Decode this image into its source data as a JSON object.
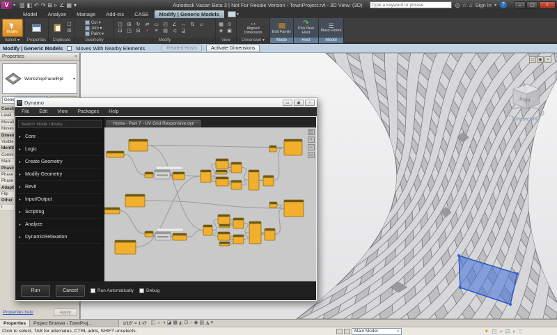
{
  "title_bar": {
    "app_title": "Autodesk Vasari Beta 3 | Not For Resale Version - TownProject.rvt - 3D View: (3D)",
    "search_placeholder": "Type a keyword or phrase",
    "sign_in_label": "Sign In",
    "qat_icons": [
      [
        "open-icon",
        "▥"
      ],
      [
        "save-icon",
        "◧"
      ],
      [
        "undo-icon",
        "↶"
      ],
      [
        "redo-icon",
        "↷"
      ],
      [
        "print-icon",
        "⊞"
      ],
      [
        "modify-icon",
        "▹"
      ],
      [
        "measure-icon",
        "∠"
      ],
      [
        "default-3d-view-icon",
        "▦"
      ],
      [
        "qat-more-icon",
        "▾"
      ]
    ],
    "title_icons": [
      [
        "search-icon",
        "◎"
      ],
      [
        "favorites-icon",
        "☆"
      ],
      [
        "communication-center-icon",
        "⌂"
      ]
    ],
    "window_buttons": [
      "–",
      "▢",
      "×"
    ]
  },
  "ribbon": {
    "tabs": [
      "Model",
      "Analyze",
      "Manage",
      "Add-Ins",
      "CASE"
    ],
    "context_tab": "Modify | Generic Models",
    "select_label": "Select ▾",
    "select_button": "Modify",
    "properties_label": "Properties",
    "clipboard_label": "Clipboard",
    "geometry_label": "Geometry",
    "geometry_items": [
      "Cut ▾",
      "Join ▾",
      "Paint ▾"
    ],
    "modify_label": "Modify",
    "modify_icons": [
      "◫",
      "⊞",
      "↻",
      "⇄",
      "▭",
      "◰",
      "∠",
      "↔",
      "⇅",
      "▱",
      "⊡",
      "◳",
      "⊟",
      "×",
      "≡",
      "▤",
      "◁",
      "⊒"
    ],
    "view_label": "View",
    "view_icons": [
      "▦",
      "⊙",
      "◈",
      "▣"
    ],
    "dimension_label": "Dimension ▾",
    "dimension_button": "Aligned Dimension",
    "mode_label": "Mode",
    "mode_button": "Edit Family",
    "host_label": "Host",
    "host_button": "Pick New Host",
    "model_label": "Model",
    "model_button": "Mass Floors"
  },
  "options_bar": {
    "context_label": "Modify | Generic Models",
    "checkbox_label": "Moves With Nearby Elements",
    "related_hosts_label": "Related Hosts",
    "activate_dimensions_label": "Activate Dimensions"
  },
  "properties_panel": {
    "header": "Properties",
    "type_name": "WorkshopPanelRpt",
    "category_selector": "Generic Models (1)",
    "edit_type_label": "Edit Type",
    "rows": [
      {
        "label": "Constraints",
        "section": true
      },
      {
        "label": "Level",
        "section": false
      },
      {
        "label": "Elevation",
        "section": false
      },
      {
        "label": "Moves With Nearby",
        "section": false
      },
      {
        "label": "Dimensions",
        "section": true
      },
      {
        "label": "Visible",
        "section": false
      },
      {
        "label": "Identity Data",
        "section": true
      },
      {
        "label": "Comments",
        "section": false
      },
      {
        "label": "Mark",
        "section": false
      },
      {
        "label": "Phasing",
        "section": true
      },
      {
        "label": "Phase Created",
        "section": false
      },
      {
        "label": "Phase Demolished",
        "section": false
      },
      {
        "label": "Adaptive Component",
        "section": true
      },
      {
        "label": "Flip",
        "section": false
      },
      {
        "label": "Other",
        "section": true
      },
      {
        "label": "t",
        "section": false
      }
    ],
    "help_link": "Properties help",
    "apply_label": "Apply"
  },
  "dynamo": {
    "window_title": "Dynamo",
    "window_buttons": [
      "▭",
      "▣",
      "×"
    ],
    "menus": [
      "File",
      "Edit",
      "View",
      "Packages",
      "Help"
    ],
    "search_placeholder": "Search Node Library...",
    "categories": [
      "Core",
      "Logic",
      "Create Geometry",
      "Modify Geometry",
      "Revit",
      "Input/Output",
      "Scripting",
      "Analyze",
      "DynamicRelaxation"
    ],
    "tab_label": "Home - Part 7 - UV Grid Responsive.dyn",
    "canvas_buttons": [
      "◰",
      "+",
      "−",
      "▭"
    ],
    "run_label": "Run",
    "cancel_label": "Cancel",
    "run_auto_label": "Run Automatically",
    "debug_label": "Debug",
    "node_color": "#f2ae2d",
    "node_header_color": "#6b5a17",
    "wire_color": "#9a9a9a",
    "nodes": [
      [
        35,
        17,
        27,
        17,
        "y"
      ],
      [
        3,
        34,
        25,
        9,
        "y"
      ],
      [
        58,
        64,
        12,
        8,
        "y"
      ],
      [
        72,
        61,
        22,
        13,
        "g"
      ],
      [
        98,
        64,
        17,
        11,
        "y"
      ],
      [
        138,
        61,
        15,
        18,
        "y"
      ],
      [
        160,
        45,
        18,
        14,
        "y"
      ],
      [
        160,
        61,
        16,
        6,
        "y"
      ],
      [
        182,
        50,
        15,
        15,
        "y"
      ],
      [
        160,
        71,
        18,
        13,
        "y"
      ],
      [
        182,
        76,
        15,
        13,
        "y"
      ],
      [
        207,
        61,
        15,
        29,
        "y"
      ],
      [
        228,
        69,
        15,
        15,
        "y"
      ],
      [
        237,
        26,
        10,
        9,
        "y"
      ],
      [
        258,
        17,
        26,
        23,
        "y"
      ],
      [
        30,
        96,
        28,
        18,
        "y"
      ],
      [
        0,
        115,
        22,
        9,
        "y"
      ],
      [
        58,
        149,
        12,
        8,
        "y"
      ],
      [
        73,
        150,
        22,
        12,
        "g"
      ],
      [
        98,
        152,
        20,
        10,
        "y"
      ],
      [
        142,
        140,
        13,
        15,
        "y"
      ],
      [
        163,
        125,
        17,
        14,
        "y"
      ],
      [
        165,
        139,
        15,
        5,
        "y"
      ],
      [
        185,
        130,
        15,
        15,
        "y"
      ],
      [
        163,
        150,
        17,
        12,
        "y"
      ],
      [
        165,
        164,
        15,
        6,
        "y"
      ],
      [
        185,
        154,
        15,
        13,
        "y"
      ],
      [
        208,
        135,
        17,
        32,
        "y"
      ],
      [
        230,
        145,
        15,
        17,
        "y"
      ],
      [
        237,
        107,
        11,
        8,
        "y"
      ],
      [
        258,
        104,
        28,
        24,
        "y"
      ],
      [
        15,
        162,
        30,
        20,
        "y"
      ]
    ],
    "wires": [
      [
        1,
        2
      ],
      [
        2,
        3
      ],
      [
        3,
        4
      ],
      [
        4,
        5
      ],
      [
        5,
        6
      ],
      [
        5,
        9
      ],
      [
        6,
        8
      ],
      [
        7,
        8
      ],
      [
        9,
        10
      ],
      [
        8,
        11
      ],
      [
        10,
        11
      ],
      [
        11,
        12
      ],
      [
        12,
        14
      ],
      [
        13,
        14
      ],
      [
        0,
        14
      ],
      [
        16,
        17
      ],
      [
        17,
        18
      ],
      [
        18,
        19
      ],
      [
        19,
        20
      ],
      [
        20,
        21
      ],
      [
        20,
        24
      ],
      [
        21,
        23
      ],
      [
        22,
        23
      ],
      [
        24,
        26
      ],
      [
        25,
        26
      ],
      [
        23,
        27
      ],
      [
        26,
        27
      ],
      [
        27,
        28
      ],
      [
        28,
        30
      ],
      [
        29,
        30
      ],
      [
        15,
        30
      ],
      [
        0,
        20
      ],
      [
        31,
        5
      ]
    ]
  },
  "viewport": {
    "viewcube_label": "Right",
    "location_label": "Boston, MA",
    "window_buttons": [
      "▭",
      "▣",
      "×"
    ],
    "selection_color": "#3f6fd8",
    "tower_fill": "#bfbfc2",
    "strip_fill": "#d9d9db",
    "strip_stroke": "#75757a"
  },
  "bottom_bar": {
    "tab_properties": "Properties",
    "tab_project_browser": "Project Browser - TownProj...",
    "scale_label": "1/16\" = 1'-0\"",
    "view_icons": [
      [
        "crop-icon",
        "◫"
      ],
      [
        "sun-icon",
        "☼"
      ],
      [
        "shadows-icon",
        "◑"
      ],
      [
        "render-icon",
        "◪"
      ],
      [
        "detail-level-icon",
        "▦"
      ],
      [
        "visual-style-icon",
        "◭"
      ],
      [
        "crop-region-icon",
        "⊡"
      ],
      [
        "hide-icon",
        "◌"
      ],
      [
        "reveal-icon",
        "◉"
      ],
      [
        "lock-icon",
        "▧"
      ],
      [
        "temporary-icon",
        "◮"
      ],
      [
        "more-icon",
        "▾"
      ]
    ],
    "main_model_label": "Main Model",
    "status_text": "Click to select, TAB for alternates, CTRL adds, SHIFT unselects.",
    "status_icons": [
      [
        "filter-icon",
        "▼",
        "#d9a41f"
      ],
      [
        "editable-only-icon",
        "◳",
        "#7a8a99"
      ],
      [
        "design-options-icon",
        "+",
        "#c0504d"
      ],
      [
        "exclude-options-icon",
        "⊡",
        "#7a8a99"
      ],
      [
        "press-drag-icon",
        "»",
        "#5a7ca6"
      ],
      [
        "filter-clear-icon",
        "▽",
        "#9aa5ad"
      ]
    ]
  }
}
